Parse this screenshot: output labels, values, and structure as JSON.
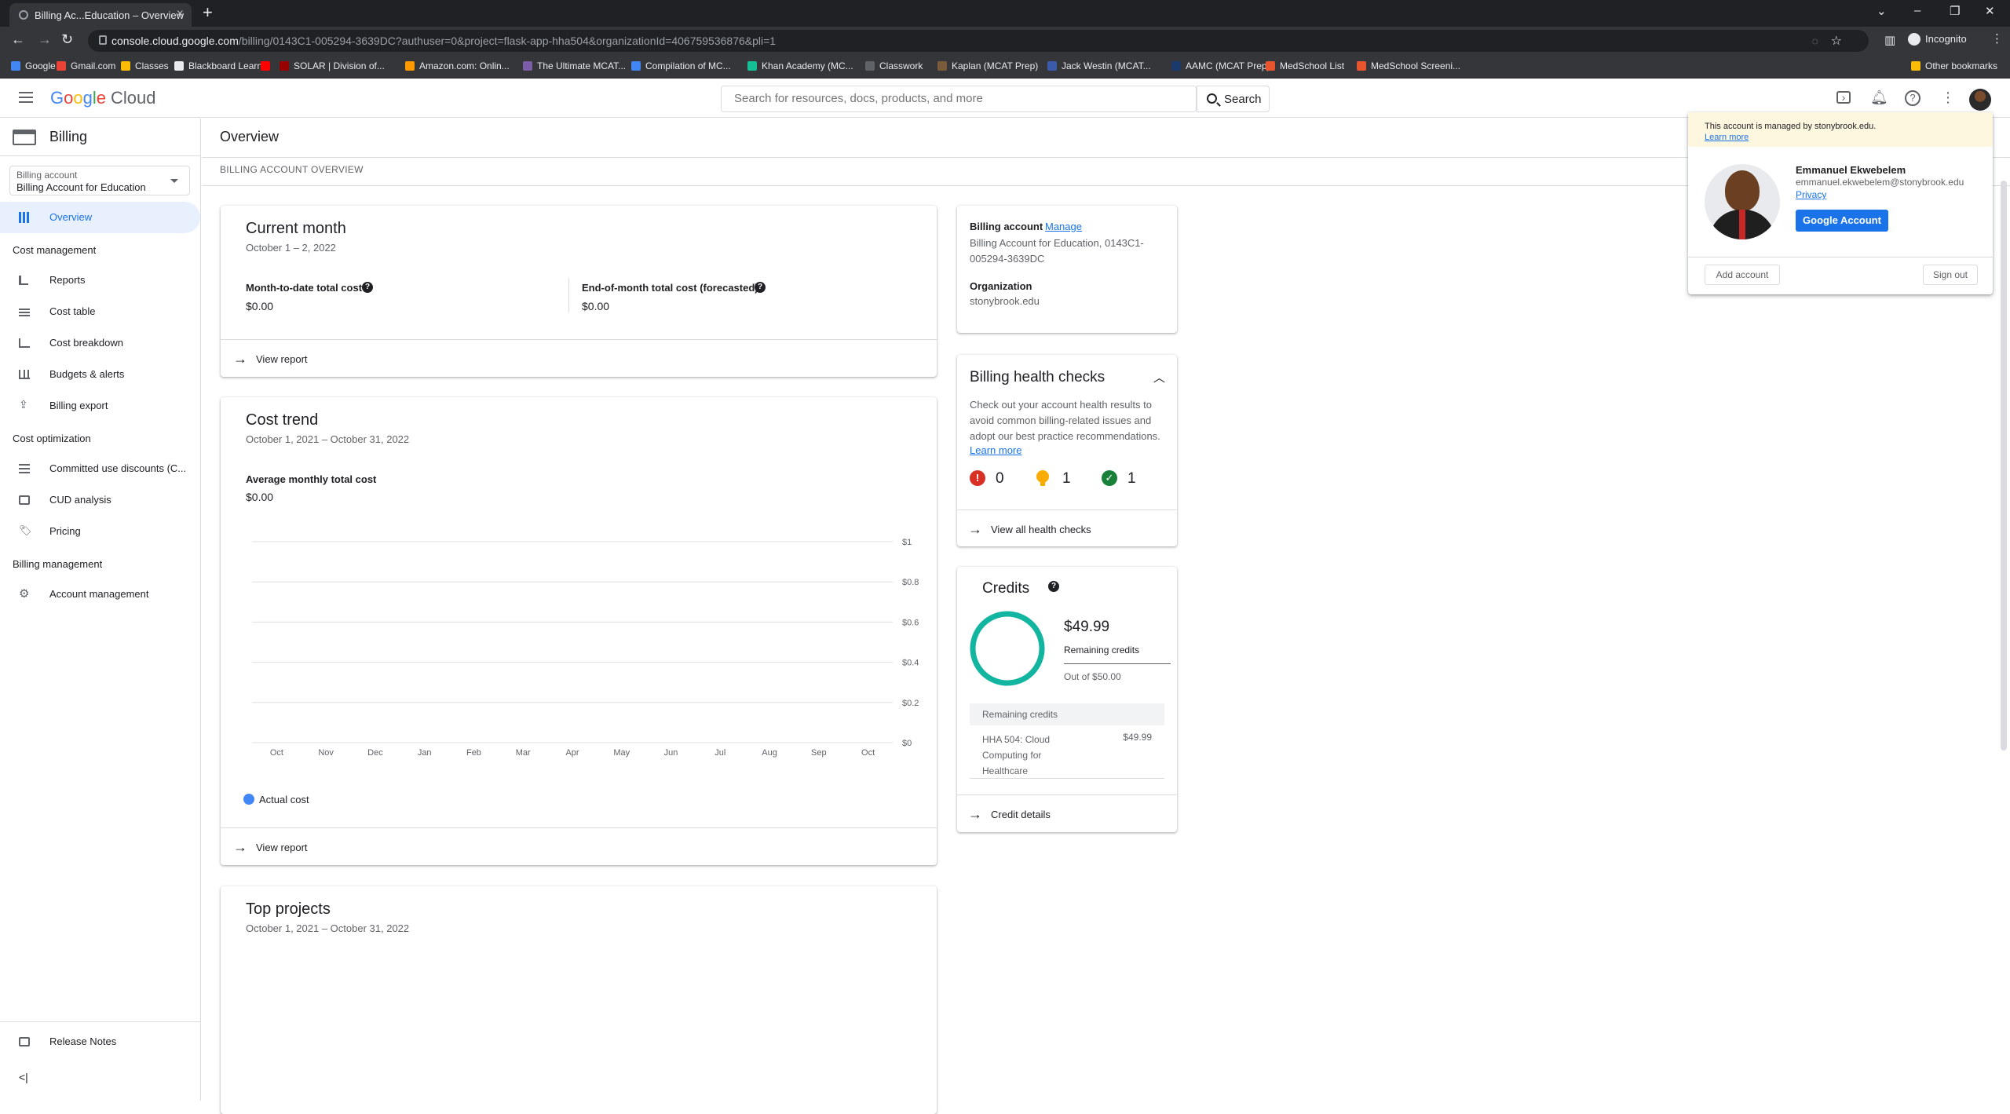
{
  "browser": {
    "tab_title": "Billing Ac...Education – Overview",
    "url_host": "console.cloud.google.com",
    "url_path": "/billing/0143C1-005294-3639DC?authuser=0&project=flask-app-hha504&organizationId=406759536876&pli=1",
    "incognito_label": "Incognito",
    "bookmarks": [
      {
        "label": "Google",
        "color": "#4285f4"
      },
      {
        "label": "Gmail.com",
        "color": "#ea4335"
      },
      {
        "label": "Classes",
        "color": "#fbbc05"
      },
      {
        "label": "Blackboard Learn",
        "color": "#e8eaed"
      },
      {
        "label": "",
        "color": "#ff0000"
      },
      {
        "label": "SOLAR | Division of...",
        "color": "#990000"
      },
      {
        "label": "Amazon.com: Onlin...",
        "color": "#ff9900"
      },
      {
        "label": "The Ultimate MCAT...",
        "color": "#7b5ea7"
      },
      {
        "label": "Compilation of MC...",
        "color": "#4285f4"
      },
      {
        "label": "Khan Academy (MC...",
        "color": "#14bf96"
      },
      {
        "label": "Classwork",
        "color": "#5f6368"
      },
      {
        "label": "Kaplan (MCAT Prep)",
        "color": "#7a5c3c"
      },
      {
        "label": "Jack Westin (MCAT...",
        "color": "#3b5ba9"
      },
      {
        "label": "AAMC (MCAT Prep)",
        "color": "#1b3a6b"
      },
      {
        "label": "MedSchool List",
        "color": "#e8542e"
      },
      {
        "label": "MedSchool Screeni...",
        "color": "#e8542e"
      }
    ],
    "other_bookmarks": "Other bookmarks"
  },
  "header": {
    "logo_google": "Google",
    "logo_cloud": "Cloud",
    "search_placeholder": "Search for resources, docs, products, and more",
    "search_button": "Search"
  },
  "sidebar": {
    "title": "Billing",
    "account_label": "Billing account",
    "account_value": "Billing Account for Education",
    "overview": "Overview",
    "sections": {
      "cost_management": "Cost management",
      "cost_optimization": "Cost optimization",
      "billing_management": "Billing management"
    },
    "items": {
      "reports": "Reports",
      "cost_table": "Cost table",
      "cost_breakdown": "Cost breakdown",
      "budgets": "Budgets & alerts",
      "billing_export": "Billing export",
      "cud": "Committed use discounts (C...",
      "cud_analysis": "CUD analysis",
      "pricing": "Pricing",
      "account_management": "Account management"
    },
    "release_notes": "Release Notes",
    "collapse": "<|"
  },
  "main": {
    "title": "Overview",
    "breadcrumb": "BILLING ACCOUNT OVERVIEW",
    "current_month": {
      "title": "Current month",
      "range": "October 1 – 2, 2022",
      "mtd_label": "Month-to-date total cost",
      "mtd_value": "$0.00",
      "eom_label": "End-of-month total cost (forecasted)",
      "eom_value": "$0.00",
      "view_report": "View report"
    },
    "cost_trend": {
      "title": "Cost trend",
      "range": "October 1, 2021 – October 31, 2022",
      "avg_label": "Average monthly total cost",
      "avg_value": "$0.00",
      "legend": "Actual cost",
      "view_report": "View report"
    },
    "top_projects": {
      "title": "Top projects",
      "range": "October 1, 2021 – October 31, 2022"
    },
    "billing_account": {
      "label": "Billing account",
      "manage": "Manage",
      "value": "Billing Account for Education, 0143C1-005294-3639DC",
      "org_label": "Organization",
      "org_value": "stonybrook.edu"
    },
    "health": {
      "title": "Billing health checks",
      "desc": "Check out your account health results to avoid common billing-related issues and adopt our best practice recommendations.",
      "learn_more": "Learn more",
      "errors": "0",
      "warnings": "1",
      "ok": "1",
      "view_all": "View all health checks"
    },
    "credits": {
      "title": "Credits",
      "amount": "$49.99",
      "remaining_label": "Remaining credits",
      "out_of": "Out of $50.00",
      "remaining_fraction": 0.9998,
      "table_header": "Remaining credits",
      "row_name": "HHA 504: Cloud Computing for Healthcare",
      "row_value": "$49.99",
      "details": "Credit details"
    }
  },
  "chart_data": {
    "type": "bar",
    "categories": [
      "Oct",
      "Nov",
      "Dec",
      "Jan",
      "Feb",
      "Mar",
      "Apr",
      "May",
      "Jun",
      "Jul",
      "Aug",
      "Sep",
      "Oct"
    ],
    "series": [
      {
        "name": "Actual cost",
        "values": [
          0,
          0,
          0,
          0,
          0,
          0,
          0,
          0,
          0,
          0,
          0,
          0,
          0
        ]
      }
    ],
    "y_ticks": [
      "$1",
      "$0.8",
      "$0.6",
      "$0.4",
      "$0.2",
      "$0"
    ],
    "ylim": [
      0,
      1
    ],
    "grid": true,
    "legend": "bottom-left",
    "series_color": "#4285f4"
  },
  "account_popup": {
    "managed_prefix": "This account is managed by",
    "managed_domain": "stonybrook.edu.",
    "learn_more": "Learn more",
    "name": "Emmanuel Ekwebelem",
    "email": "emmanuel.ekwebelem@stonybrook.edu",
    "privacy": "Privacy",
    "google_account": "Google Account",
    "add_account": "Add account",
    "sign_out": "Sign out"
  },
  "colors": {
    "accent": "#1a73e8",
    "credit_ring": "#12b5a0",
    "error": "#d93025",
    "warning": "#f9ab00",
    "ok": "#188038"
  }
}
